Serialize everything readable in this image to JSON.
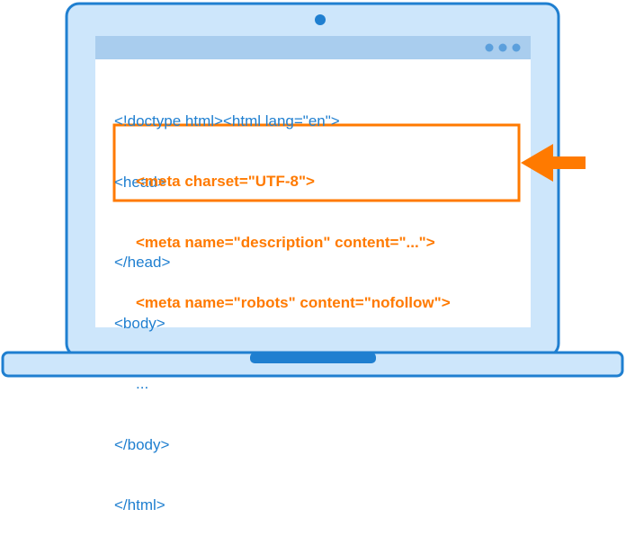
{
  "code": {
    "top_lines": [
      "<!doctype html><html lang=\"en\">",
      "<head>"
    ],
    "highlight_lines": [
      "<meta charset=\"UTF-8\">",
      "<meta name=\"description\" content=\"...\">",
      "<meta name=\"robots\" content=\"nofollow\">"
    ],
    "bottom_lines": [
      "</head>",
      "<body>",
      "...",
      "</body>",
      "</html>"
    ]
  },
  "colors": {
    "laptop_fill": "#cde6fb",
    "laptop_outline": "#1f7fd0",
    "titlebar": "#a9cdee",
    "code_text": "#1f7fd0",
    "highlight": "#ff7a00"
  },
  "icons": [
    "camera-dot-icon",
    "window-dots-icon",
    "arrow-left-icon"
  ]
}
